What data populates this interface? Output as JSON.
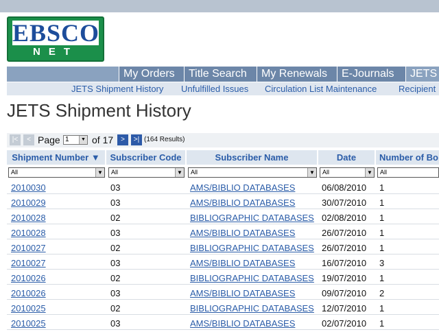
{
  "logo": {
    "top": "EBSCO",
    "bottom": "NET"
  },
  "main_nav": [
    "My Orders",
    "Title Search",
    "My Renewals",
    "E-Journals",
    "JETS"
  ],
  "sub_nav": [
    "JETS Shipment History",
    "Unfulfilled Issues",
    "Circulation List Maintenance",
    "Recipient"
  ],
  "page_title": "JETS Shipment History",
  "pager": {
    "page_label": "Page",
    "current_page": "1",
    "of_label": "of 17",
    "results": "(164 Results)"
  },
  "columns": [
    "Shipment Number",
    "Subscriber Code",
    "Subscriber Name",
    "Date",
    "Number of Bo"
  ],
  "sort_indicator": "▼",
  "filter_value": "All",
  "rows": [
    {
      "shipment": "2010030",
      "code": "03",
      "name": "AMS/BIBLIO DATABASES",
      "date": "06/08/2010",
      "boxes": "1"
    },
    {
      "shipment": "2010029",
      "code": "03",
      "name": "AMS/BIBLIO DATABASES",
      "date": "30/07/2010",
      "boxes": "1"
    },
    {
      "shipment": "2010028",
      "code": "02",
      "name": "BIBLIOGRAPHIC DATABASES",
      "date": "02/08/2010",
      "boxes": "1"
    },
    {
      "shipment": "2010028",
      "code": "03",
      "name": "AMS/BIBLIO DATABASES",
      "date": "26/07/2010",
      "boxes": "1"
    },
    {
      "shipment": "2010027",
      "code": "02",
      "name": "BIBLIOGRAPHIC DATABASES",
      "date": "26/07/2010",
      "boxes": "1"
    },
    {
      "shipment": "2010027",
      "code": "03",
      "name": "AMS/BIBLIO DATABASES",
      "date": "16/07/2010",
      "boxes": "3"
    },
    {
      "shipment": "2010026",
      "code": "02",
      "name": "BIBLIOGRAPHIC DATABASES",
      "date": "19/07/2010",
      "boxes": "1"
    },
    {
      "shipment": "2010026",
      "code": "03",
      "name": "AMS/BIBLIO DATABASES",
      "date": "09/07/2010",
      "boxes": "2"
    },
    {
      "shipment": "2010025",
      "code": "02",
      "name": "BIBLIOGRAPHIC DATABASES",
      "date": "12/07/2010",
      "boxes": "1"
    },
    {
      "shipment": "2010025",
      "code": "03",
      "name": "AMS/BIBLIO DATABASES",
      "date": "02/07/2010",
      "boxes": "1"
    }
  ],
  "colors": {
    "accent": "#2a5ca8",
    "nav": "#6c86a8",
    "header_bg": "#dee6ef",
    "logo_green": "#1b8f4a"
  }
}
